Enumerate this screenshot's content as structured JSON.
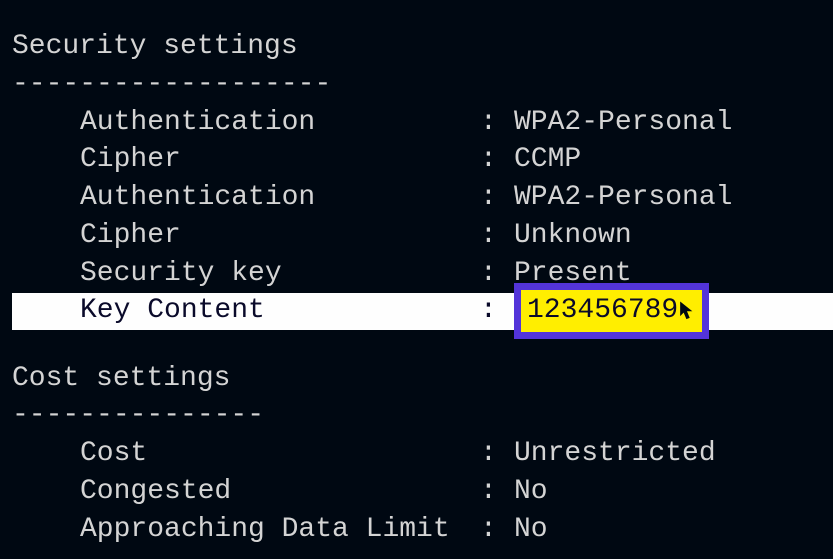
{
  "security": {
    "title": "Security settings",
    "divider": "-------------------",
    "rows": {
      "auth1": {
        "label": "Authentication",
        "value": "WPA2-Personal"
      },
      "cipher1": {
        "label": "Cipher",
        "value": "CCMP"
      },
      "auth2": {
        "label": "Authentication",
        "value": "WPA2-Personal"
      },
      "cipher2": {
        "label": "Cipher",
        "value": "Unknown"
      },
      "seckey": {
        "label": "Security key",
        "value": "Present"
      },
      "keycontent": {
        "label": "Key Content",
        "value": "123456789"
      }
    }
  },
  "cost": {
    "title": "Cost settings",
    "divider": "---------------",
    "rows": {
      "cost": {
        "label": "Cost",
        "value": "Unrestricted"
      },
      "congested": {
        "label": "Congested",
        "value": "No"
      },
      "datalimit": {
        "label": "Approaching Data Limit ",
        "value": "No"
      }
    }
  },
  "colon": ":"
}
